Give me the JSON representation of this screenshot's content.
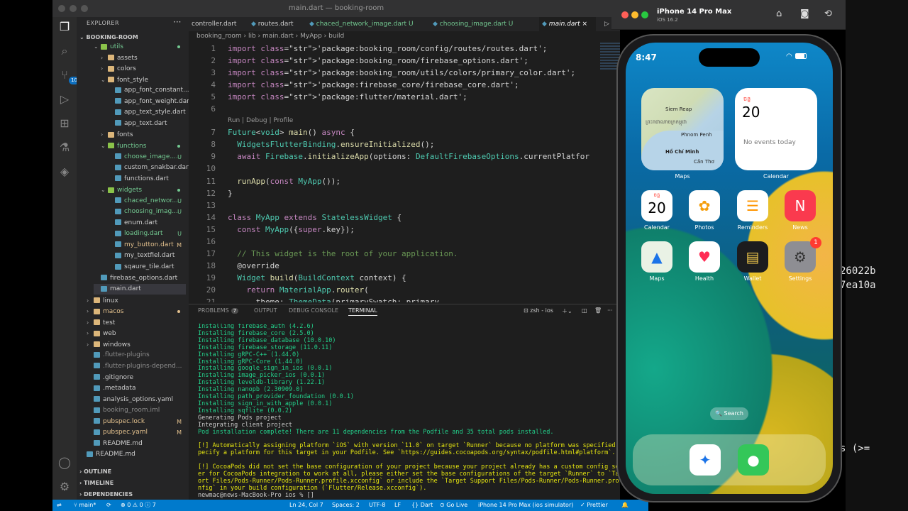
{
  "vscode": {
    "window_title": "main.dart — booking-room",
    "explorer": {
      "title": "EXPLORER",
      "root": "BOOKING-ROOM",
      "items": [
        {
          "label": "utils",
          "kind": "folder",
          "open": true,
          "depth": 1,
          "color": "#73c991",
          "status": "dot"
        },
        {
          "label": "assets",
          "kind": "folder",
          "open": false,
          "depth": 2,
          "color": "#ccc",
          "status": ""
        },
        {
          "label": "colors",
          "kind": "folder",
          "open": false,
          "depth": 2,
          "color": "#ccc",
          "status": ""
        },
        {
          "label": "font_style",
          "kind": "folder",
          "open": true,
          "depth": 2,
          "color": "#ccc",
          "status": ""
        },
        {
          "label": "app_font_constant....",
          "kind": "file",
          "depth": 3,
          "color": "#ccc",
          "status": ""
        },
        {
          "label": "app_font_weight.dart",
          "kind": "file",
          "depth": 3,
          "color": "#ccc",
          "status": ""
        },
        {
          "label": "app_text_style.dart",
          "kind": "file",
          "depth": 3,
          "color": "#ccc",
          "status": ""
        },
        {
          "label": "app_text.dart",
          "kind": "file",
          "depth": 3,
          "color": "#ccc",
          "status": ""
        },
        {
          "label": "fonts",
          "kind": "folder",
          "open": false,
          "depth": 2,
          "color": "#ccc",
          "status": ""
        },
        {
          "label": "functions",
          "kind": "folder",
          "open": true,
          "depth": 2,
          "color": "#73c991",
          "status": "dot"
        },
        {
          "label": "choose_image....",
          "kind": "file",
          "depth": 3,
          "color": "#73c991",
          "status": "U"
        },
        {
          "label": "custom_snakbar.dart",
          "kind": "file",
          "depth": 3,
          "color": "#ccc",
          "status": ""
        },
        {
          "label": "functions.dart",
          "kind": "file",
          "depth": 3,
          "color": "#ccc",
          "status": ""
        },
        {
          "label": "widgets",
          "kind": "folder",
          "open": true,
          "depth": 2,
          "color": "#73c991",
          "status": "dot"
        },
        {
          "label": "chaced_networ...",
          "kind": "file",
          "depth": 3,
          "color": "#73c991",
          "status": "U"
        },
        {
          "label": "choosing_imag...",
          "kind": "file",
          "depth": 3,
          "color": "#73c991",
          "status": "U"
        },
        {
          "label": "enum.dart",
          "kind": "file",
          "depth": 3,
          "color": "#ccc",
          "status": ""
        },
        {
          "label": "loading.dart",
          "kind": "file",
          "depth": 3,
          "color": "#73c991",
          "status": "U"
        },
        {
          "label": "my_button.dart",
          "kind": "file",
          "depth": 3,
          "color": "#e2c08d",
          "status": "M"
        },
        {
          "label": "my_textfiel.dart",
          "kind": "file",
          "depth": 3,
          "color": "#ccc",
          "status": ""
        },
        {
          "label": "sqaure_tile.dart",
          "kind": "file",
          "depth": 3,
          "color": "#ccc",
          "status": ""
        },
        {
          "label": "firebase_options.dart",
          "kind": "file",
          "depth": 1,
          "color": "#ccc",
          "status": ""
        },
        {
          "label": "main.dart",
          "kind": "file",
          "depth": 1,
          "color": "#ccc",
          "status": "",
          "selected": true
        },
        {
          "label": "linux",
          "kind": "folder",
          "open": false,
          "depth": 0,
          "color": "#ccc",
          "status": ""
        },
        {
          "label": "macos",
          "kind": "folder",
          "open": false,
          "depth": 0,
          "color": "#e2c08d",
          "status": "dot"
        },
        {
          "label": "test",
          "kind": "folder",
          "open": false,
          "depth": 0,
          "color": "#ccc",
          "status": ""
        },
        {
          "label": "web",
          "kind": "folder",
          "open": false,
          "depth": 0,
          "color": "#ccc",
          "status": ""
        },
        {
          "label": "windows",
          "kind": "folder",
          "open": false,
          "depth": 0,
          "color": "#ccc",
          "status": ""
        },
        {
          "label": ".flutter-plugins",
          "kind": "file",
          "depth": 0,
          "color": "#8b8b8b",
          "status": ""
        },
        {
          "label": ".flutter-plugins-depend...",
          "kind": "file",
          "depth": 0,
          "color": "#8b8b8b",
          "status": ""
        },
        {
          "label": ".gitignore",
          "kind": "file",
          "depth": 0,
          "color": "#ccc",
          "status": ""
        },
        {
          "label": ".metadata",
          "kind": "file",
          "depth": 0,
          "color": "#ccc",
          "status": ""
        },
        {
          "label": "analysis_options.yaml",
          "kind": "file",
          "depth": 0,
          "color": "#ccc",
          "status": ""
        },
        {
          "label": "booking_room.iml",
          "kind": "file",
          "depth": 0,
          "color": "#8b8b8b",
          "status": ""
        },
        {
          "label": "pubspec.lock",
          "kind": "file",
          "depth": 0,
          "color": "#e2c08d",
          "status": "M"
        },
        {
          "label": "pubspec.yaml",
          "kind": "file",
          "depth": 0,
          "color": "#e2c08d",
          "status": "M"
        },
        {
          "label": "README.md",
          "kind": "file",
          "depth": 0,
          "color": "#ccc",
          "status": ""
        },
        {
          "label": "README.md",
          "kind": "file",
          "depth": -1,
          "color": "#ccc",
          "status": ""
        }
      ],
      "outline": "OUTLINE",
      "timeline": "TIMELINE",
      "dependencies": "DEPENDENCIES"
    },
    "tabs": [
      {
        "label": "controller.dart",
        "status": "",
        "active": false
      },
      {
        "label": "routes.dart",
        "status": "",
        "active": false
      },
      {
        "label": "chaced_network_image.dart",
        "status": "U",
        "active": false
      },
      {
        "label": "choosing_image.dart",
        "status": "U",
        "active": false
      },
      {
        "label": "main.dart",
        "status": "×",
        "active": true
      }
    ],
    "breadcrumb": "booking_room  ›  lib  ›  main.dart  ›  MyApp  ›  build",
    "codelens": "Run | Debug | Profile",
    "code_lines": [
      {
        "n": "1",
        "t": "import 'package:booking_room/config/routes/routes.dart';"
      },
      {
        "n": "2",
        "t": "import 'package:booking_room/firebase_options.dart';"
      },
      {
        "n": "3",
        "t": "import 'package:booking_room/utils/colors/primary_color.dart';"
      },
      {
        "n": "4",
        "t": "import 'package:firebase_core/firebase_core.dart';"
      },
      {
        "n": "5",
        "t": "import 'package:flutter/material.dart';"
      },
      {
        "n": "6",
        "t": ""
      },
      {
        "n": "7",
        "t": "Future<void> main() async {"
      },
      {
        "n": "8",
        "t": "  WidgetsFlutterBinding.ensureInitialized();"
      },
      {
        "n": "9",
        "t": "  await Firebase.initializeApp(options: DefaultFirebaseOptions.currentPlatfor"
      },
      {
        "n": "10",
        "t": ""
      },
      {
        "n": "11",
        "t": "  runApp(const MyApp());"
      },
      {
        "n": "12",
        "t": "}"
      },
      {
        "n": "13",
        "t": ""
      },
      {
        "n": "14",
        "t": "class MyApp extends StatelessWidget {"
      },
      {
        "n": "15",
        "t": "  const MyApp({super.key});"
      },
      {
        "n": "16",
        "t": ""
      },
      {
        "n": "17",
        "t": "  // This widget is the root of your application."
      },
      {
        "n": "18",
        "t": "  @override"
      },
      {
        "n": "19",
        "t": "  Widget build(BuildContext context) {"
      },
      {
        "n": "20",
        "t": "    return MaterialApp.router("
      },
      {
        "n": "21",
        "t": "      theme: ThemeData(primarySwatch: primary"
      }
    ],
    "panel": {
      "tabs": [
        "PROBLEMS",
        "OUTPUT",
        "DEBUG CONSOLE",
        "TERMINAL"
      ],
      "problems_count": "7",
      "shell": "zsh - ios",
      "terminal_lines": [
        {
          "c": "g",
          "t": "Installing firebase_auth (4.2.6)"
        },
        {
          "c": "g",
          "t": "Installing firebase_core (2.5.0)"
        },
        {
          "c": "g",
          "t": "Installing firebase_database (10.0.10)"
        },
        {
          "c": "g",
          "t": "Installing firebase_storage (11.0.11)"
        },
        {
          "c": "g",
          "t": "Installing gRPC-C++ (1.44.0)"
        },
        {
          "c": "g",
          "t": "Installing gRPC-Core (1.44.0)"
        },
        {
          "c": "g",
          "t": "Installing google_sign_in_ios (0.0.1)"
        },
        {
          "c": "g",
          "t": "Installing image_picker_ios (0.0.1)"
        },
        {
          "c": "g",
          "t": "Installing leveldb-library (1.22.1)"
        },
        {
          "c": "g",
          "t": "Installing nanopb (2.30909.0)"
        },
        {
          "c": "g",
          "t": "Installing path_provider_foundation (0.0.1)"
        },
        {
          "c": "g",
          "t": "Installing sign_in_with_apple (0.0.1)"
        },
        {
          "c": "g",
          "t": "Installing sqflite (0.0.2)"
        },
        {
          "c": "w",
          "t": "Generating Pods project"
        },
        {
          "c": "w",
          "t": "Integrating client project"
        },
        {
          "c": "g",
          "t": "Pod installation complete! There are 11 dependencies from the Podfile and 35 total pods installed."
        },
        {
          "c": "w",
          "t": ""
        },
        {
          "c": "y",
          "t": "[!] Automatically assigning platform `iOS` with version `11.0` on target `Runner` because no platform was specified. Pl"
        },
        {
          "c": "y",
          "t": "pecify a platform for this target in your Podfile. See `https://guides.cocoapods.org/syntax/podfile.html#platform`."
        },
        {
          "c": "w",
          "t": ""
        },
        {
          "c": "y",
          "t": "[!] CocoaPods did not set the base configuration of your project because your project already has a custom config set."
        },
        {
          "c": "y",
          "t": "er for CocoaPods integration to work at all, please either set the base configurations of the target `Runner` to `Targe"
        },
        {
          "c": "y",
          "t": "ort Files/Pods-Runner/Pods-Runner.profile.xcconfig` or include the `Target Support Files/Pods-Runner/Pods-Runner.profile"
        },
        {
          "c": "y",
          "t": "nfig` in your build configuration (`Flutter/Release.xcconfig`)."
        },
        {
          "c": "w",
          "t": "newmac@news-MacBook-Pro ios % []"
        }
      ]
    },
    "statusbar": {
      "branch": "main*",
      "errors": "⊗ 0 ⚠ 0 ⓘ 7",
      "position": "Ln 24, Col 7",
      "spaces": "Spaces: 2",
      "encoding": "UTF-8",
      "eol": "LF",
      "language": "{} Dart",
      "golive": "Go Live",
      "device": "iPhone 14 Pro Max (ios simulator)",
      "prettier": "✓ Prettier"
    }
  },
  "simulator": {
    "device_name": "iPhone 14 Pro Max",
    "os": "iOS 16.2",
    "status_time": "8:47",
    "map_widget": {
      "label": "Maps",
      "cities": [
        "Siem Reap",
        "ព្រះរាជាណាចក្រកម្ពុជា",
        "Phnom Penh",
        "Hồ Chí Minh",
        "Cần Thơ"
      ]
    },
    "calendar_widget": {
      "label": "Calendar",
      "weekday": "ចន្ទ",
      "day": "20",
      "events": "No events today"
    },
    "apps": [
      {
        "label": "Calendar",
        "bg": "#ffffff",
        "glyph": "20",
        "badge": ""
      },
      {
        "label": "Photos",
        "bg": "#ffffff",
        "glyph": "✿",
        "badge": ""
      },
      {
        "label": "Reminders",
        "bg": "#ffffff",
        "glyph": "☰",
        "badge": ""
      },
      {
        "label": "News",
        "bg": "#fa3a4e",
        "glyph": "N",
        "badge": ""
      },
      {
        "label": "Maps",
        "bg": "#e9f2e5",
        "glyph": "▲",
        "badge": ""
      },
      {
        "label": "Health",
        "bg": "#ffffff",
        "glyph": "♥",
        "badge": ""
      },
      {
        "label": "Wallet",
        "bg": "#1c1c1e",
        "glyph": "▤",
        "badge": ""
      },
      {
        "label": "Settings",
        "bg": "#8e8e93",
        "glyph": "⚙",
        "badge": "1"
      }
    ],
    "calendar_app_weekday": "ចន្ទ",
    "search_label": "🔍 Search",
    "dock": [
      {
        "label": "safari-app",
        "glyph": "✦",
        "bg": "#ffffff"
      },
      {
        "label": "messages-app",
        "glyph": "●",
        "bg": "#34c759"
      }
    ]
  },
  "background_terminal": {
    "lines": [
      "26022b",
      "7ea10a",
      "s (>="
    ]
  }
}
